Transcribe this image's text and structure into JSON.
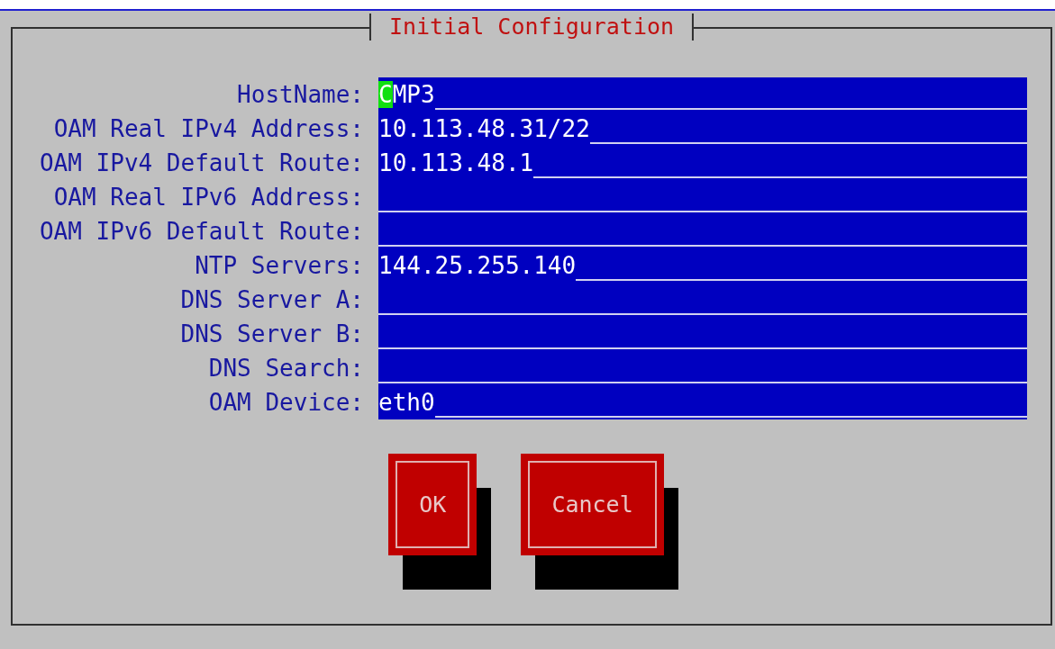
{
  "dialog": {
    "title": "Initial Configuration"
  },
  "fields": [
    {
      "label": "HostName:",
      "value": "CMP3",
      "focused": true
    },
    {
      "label": "OAM Real IPv4 Address:",
      "value": "10.113.48.31/22",
      "focused": false
    },
    {
      "label": "OAM IPv4 Default Route:",
      "value": "10.113.48.1",
      "focused": false
    },
    {
      "label": "OAM Real IPv6 Address:",
      "focused": false
    },
    {
      "label": "OAM IPv6 Default Route:",
      "focused": false
    },
    {
      "label": "NTP Servers:",
      "value": "144.25.255.140",
      "focused": false
    },
    {
      "label": "DNS Server A:",
      "focused": false
    },
    {
      "label": "DNS Server B:",
      "focused": false
    },
    {
      "label": "DNS Search:",
      "focused": false
    },
    {
      "label": "OAM Device:",
      "value": "eth0",
      "focused": false
    }
  ],
  "buttons": [
    "OK",
    "Cancel"
  ]
}
